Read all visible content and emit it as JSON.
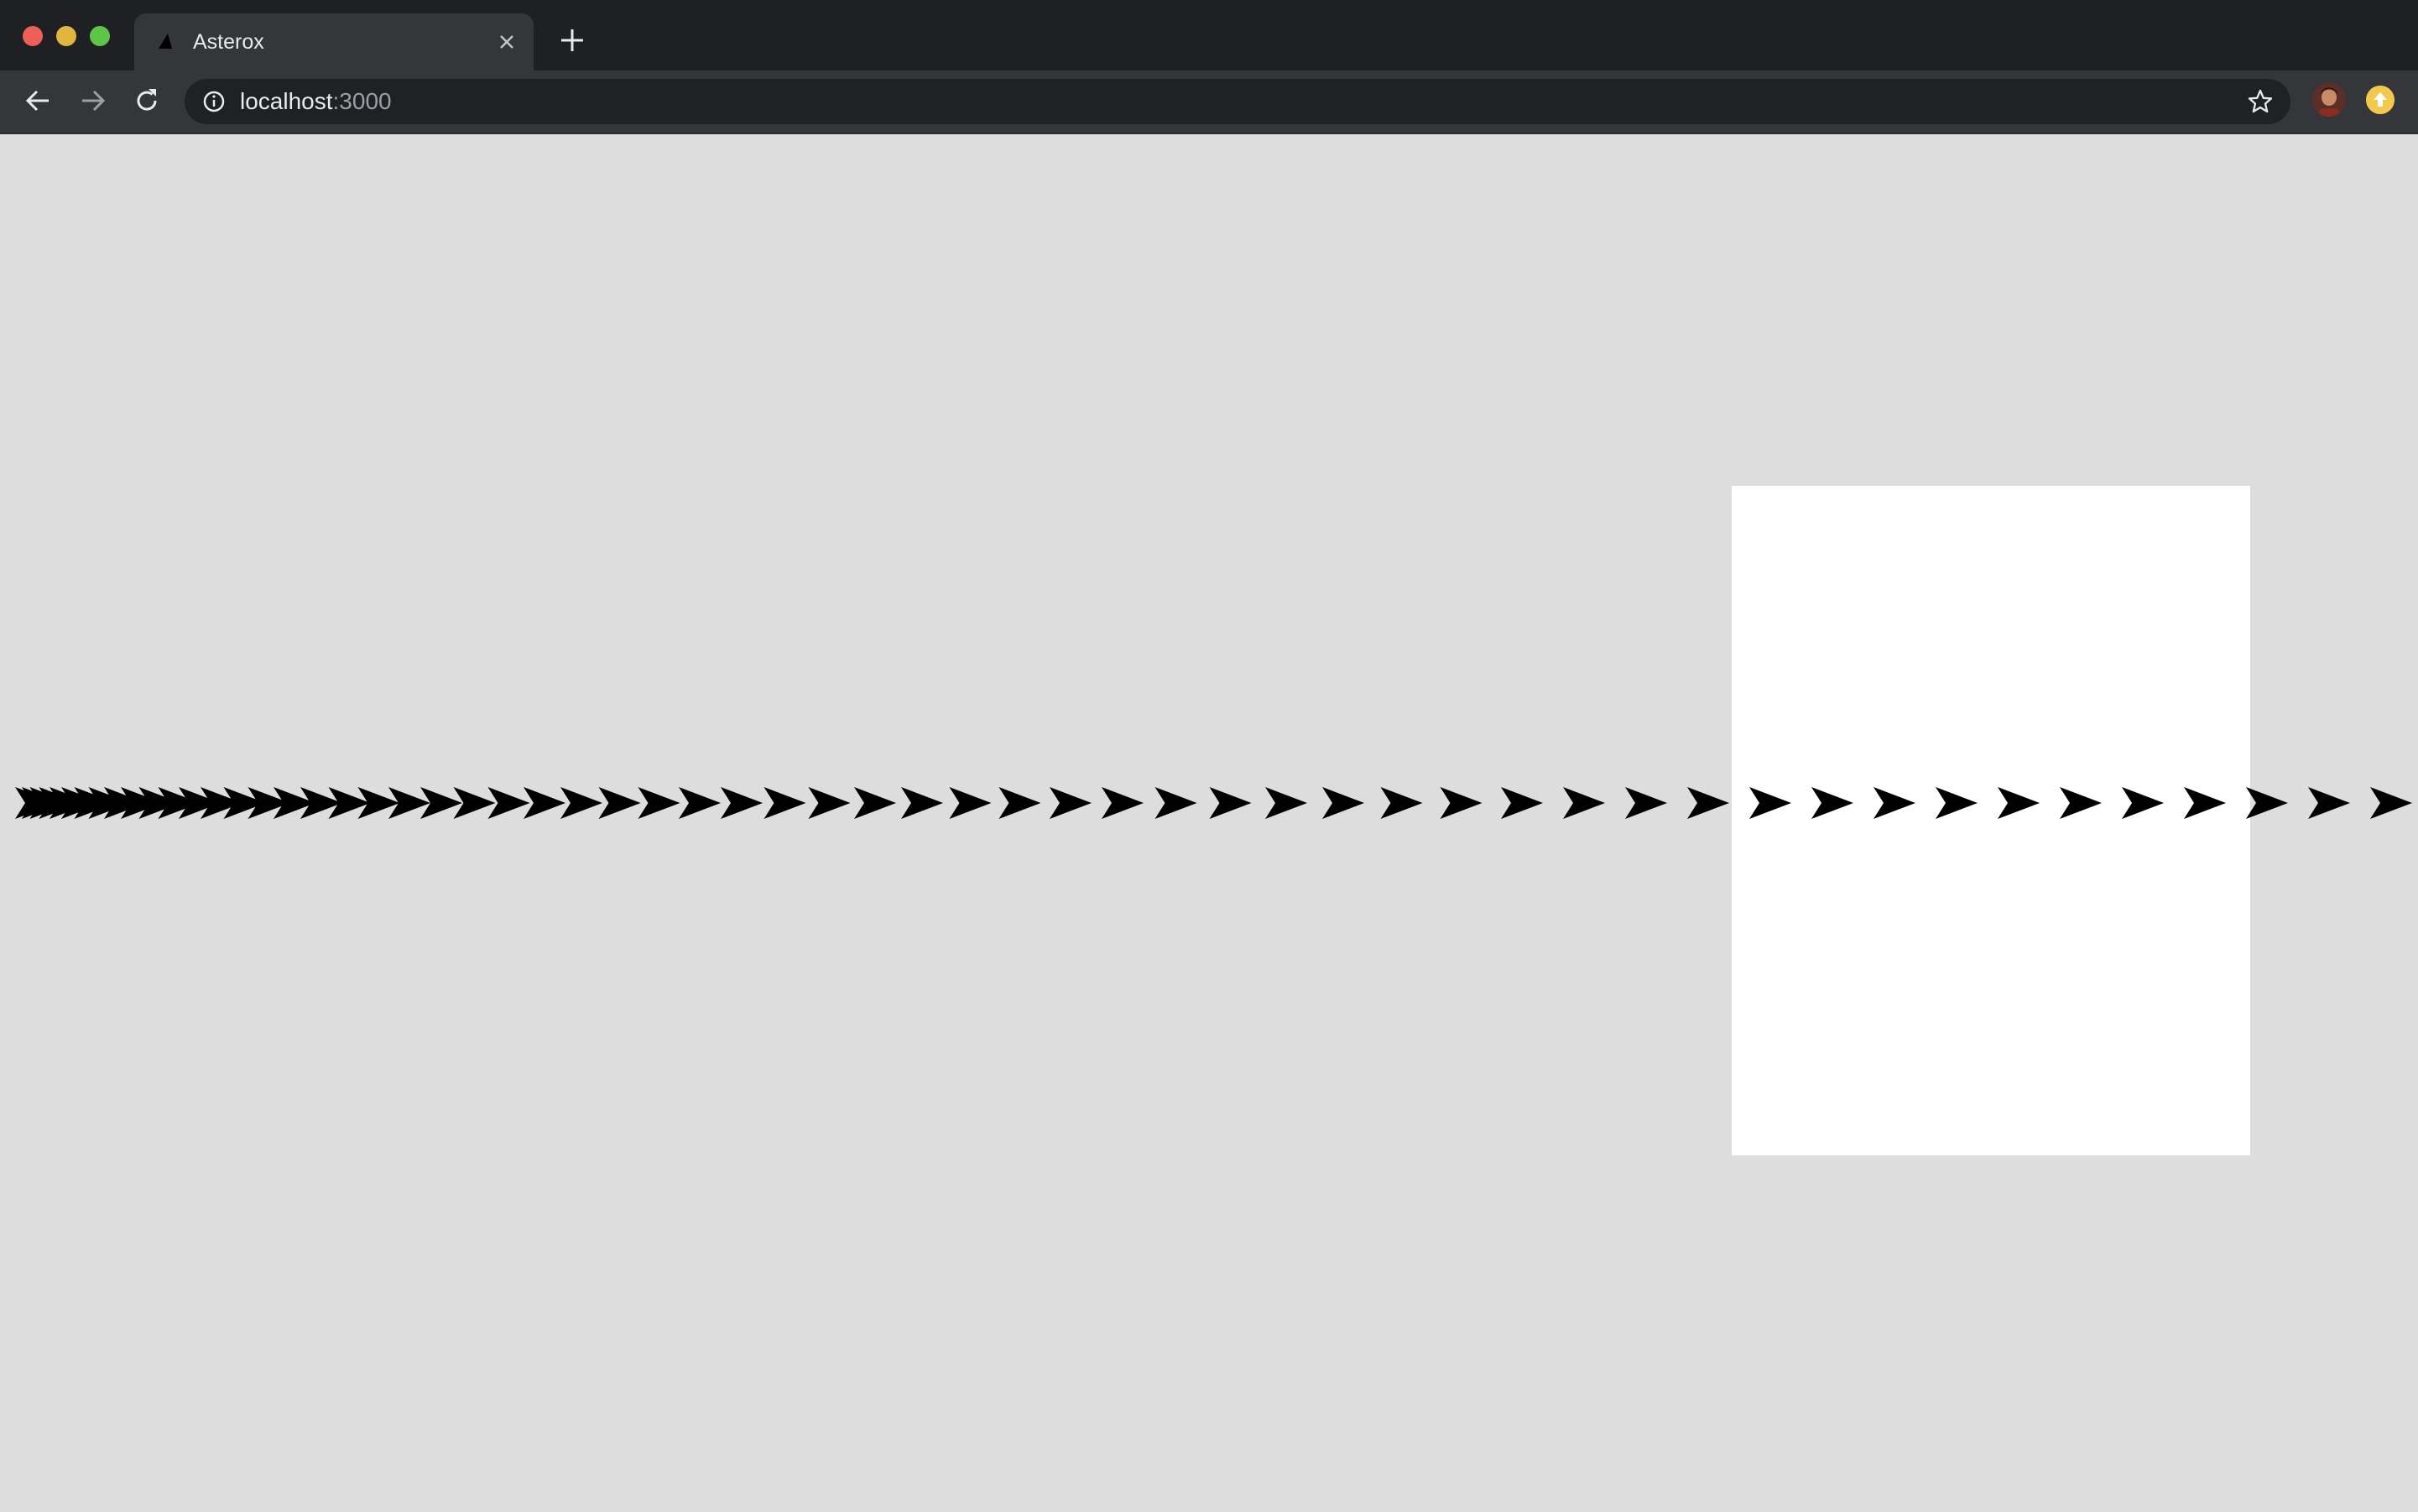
{
  "browser": {
    "tab": {
      "title": "Asterox",
      "favicon": "triangle-icon",
      "close_icon": "close-icon"
    },
    "new_tab_icon": "plus-icon",
    "toolbar": {
      "back_icon": "arrow-left-icon",
      "forward_icon": "arrow-right-icon",
      "reload_icon": "reload-icon",
      "info_icon": "info-icon",
      "url_host": "localhost",
      "url_port": ":3000",
      "bookmark_icon": "star-icon",
      "profile_icon": "avatar",
      "extension_icon": "update-icon"
    }
  },
  "game": {
    "background_color": "#dddddd",
    "panel_color": "#ffffff",
    "ship_color": "#000000",
    "ship_icon": "ship-arrow-icon"
  }
}
